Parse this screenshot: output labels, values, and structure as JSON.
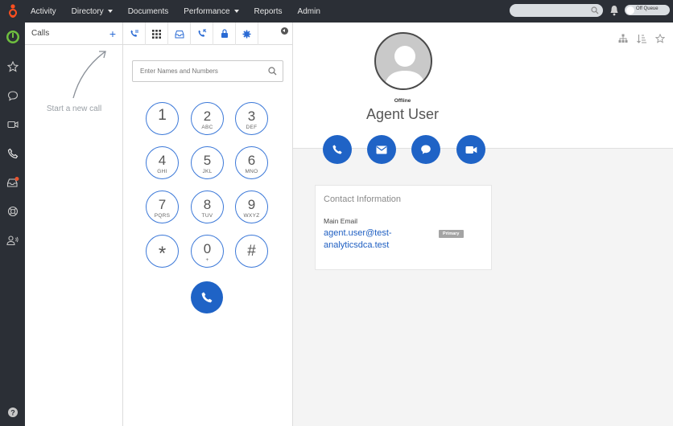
{
  "topnav": {
    "items": [
      {
        "label": "Activity",
        "has_caret": false
      },
      {
        "label": "Directory",
        "has_caret": true
      },
      {
        "label": "Documents",
        "has_caret": false
      },
      {
        "label": "Performance",
        "has_caret": true
      },
      {
        "label": "Reports",
        "has_caret": false
      },
      {
        "label": "Admin",
        "has_caret": false
      }
    ],
    "search_placeholder": "",
    "queue_toggle_label": "Off Queue"
  },
  "leftnav": {
    "icons": [
      "status-icon",
      "favorites-icon",
      "chat-icon",
      "video-icon",
      "calls-icon",
      "inbox-icon",
      "help-support-icon",
      "people-icon",
      "help-icon"
    ],
    "inbox_badge_color": "#e8542f"
  },
  "calls": {
    "title": "Calls",
    "add_label": "+",
    "hint": "Start a new call"
  },
  "dialpad": {
    "input_placeholder": "Enter Names and Numbers",
    "keys": [
      {
        "digit": "1",
        "letters": ""
      },
      {
        "digit": "2",
        "letters": "ABC"
      },
      {
        "digit": "3",
        "letters": "DEF"
      },
      {
        "digit": "4",
        "letters": "GHI"
      },
      {
        "digit": "5",
        "letters": "JKL"
      },
      {
        "digit": "6",
        "letters": "MNO"
      },
      {
        "digit": "7",
        "letters": "PQRS"
      },
      {
        "digit": "8",
        "letters": "TUV"
      },
      {
        "digit": "9",
        "letters": "WXYZ"
      },
      {
        "digit": "*",
        "letters": ""
      },
      {
        "digit": "0",
        "letters": "+"
      },
      {
        "digit": "#",
        "letters": ""
      }
    ]
  },
  "contact": {
    "status": "Offline",
    "name": "Agent User",
    "info_title": "Contact Information",
    "email_label": "Main Email",
    "email": "agent.user@test-analyticsdca.test",
    "email_line1": "agent.user@test-",
    "email_line2": "analyticsdca.test",
    "primary_badge": "Primary"
  },
  "colors": {
    "accent": "#1f63c6",
    "topbar": "#2b2f36",
    "key_border": "#3b78d8",
    "link": "#1f5fc2"
  }
}
